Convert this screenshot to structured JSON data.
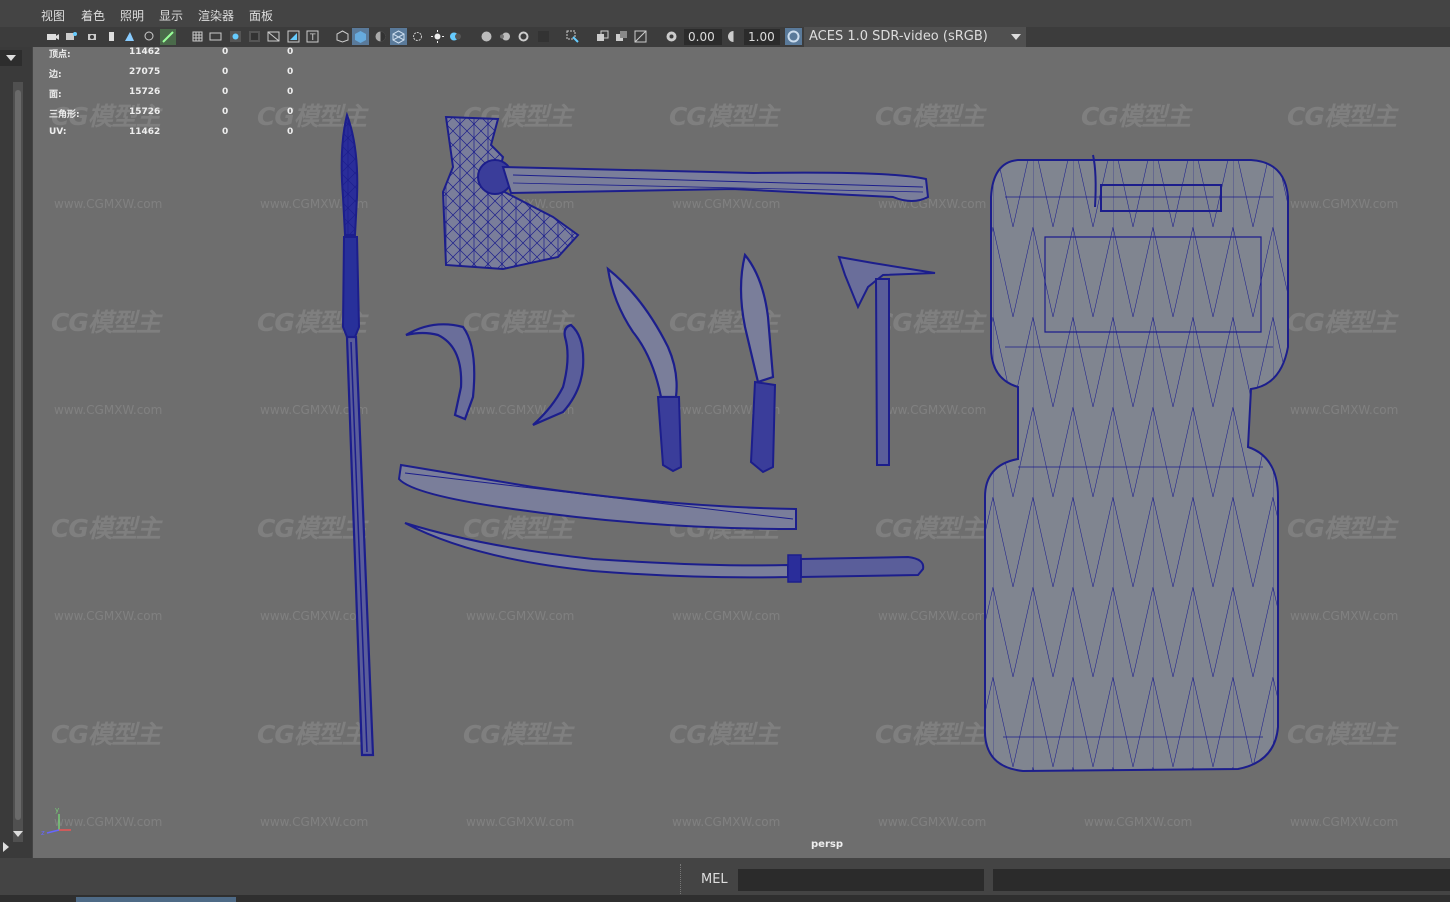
{
  "menu": [
    "视图",
    "着色",
    "照明",
    "显示",
    "渲染器",
    "面板"
  ],
  "toolbar": {
    "exposure": "0.00",
    "gamma": "1.00",
    "color_space": "ACES 1.0 SDR-video (sRGB)"
  },
  "hud": {
    "rows": [
      {
        "label": "顶点:",
        "v1": "11462",
        "v2": "0",
        "v3": "0"
      },
      {
        "label": "边:",
        "v1": "27075",
        "v2": "0",
        "v3": "0"
      },
      {
        "label": "面:",
        "v1": "15726",
        "v2": "0",
        "v3": "0"
      },
      {
        "label": "三角形:",
        "v1": "15726",
        "v2": "0",
        "v3": "0"
      },
      {
        "label": "UV:",
        "v1": "11462",
        "v2": "0",
        "v3": "0"
      }
    ]
  },
  "camera_label": "persp",
  "watermark": {
    "logo": "CG模型主",
    "url": "www.CGMXW.com"
  },
  "commandline": {
    "label": "MEL"
  },
  "colors": {
    "wire": "#1c1e8c",
    "mesh_fill": "#808590",
    "viewport_bg": "#6e6e6e"
  }
}
